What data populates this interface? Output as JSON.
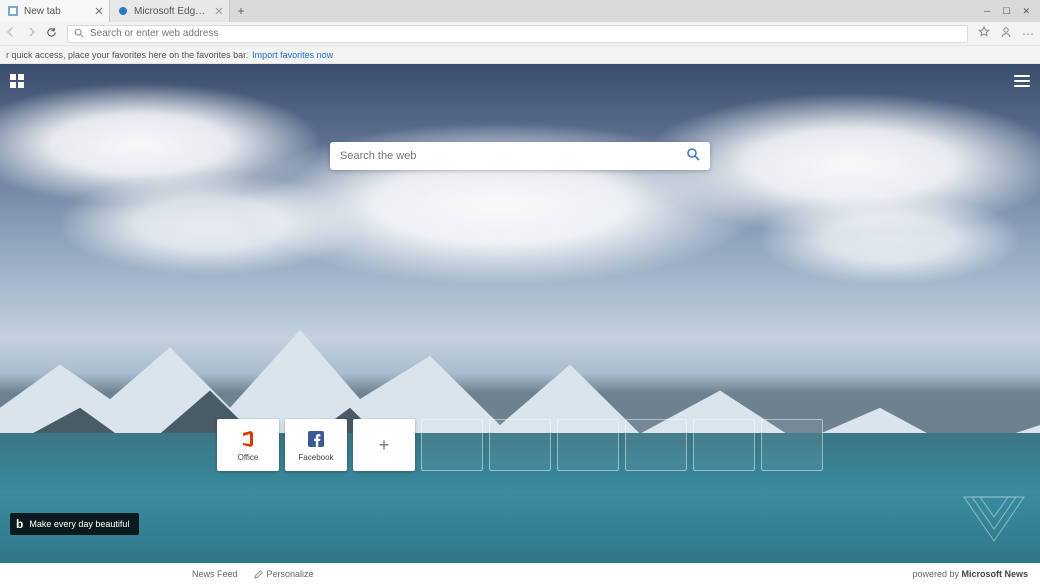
{
  "tabs": [
    {
      "title": "New tab",
      "active": true
    },
    {
      "title": "Microsoft Edge Insider",
      "active": false
    }
  ],
  "address_bar": {
    "placeholder": "Search or enter web address"
  },
  "favorites_bar": {
    "hint": "r quick access, place your favorites here on the favorites bar.",
    "link": "Import favorites now"
  },
  "ntp": {
    "web_search_placeholder": "Search the web",
    "tiles": [
      {
        "type": "site",
        "label": "Office",
        "icon": "office"
      },
      {
        "type": "site",
        "label": "Facebook",
        "icon": "facebook"
      },
      {
        "type": "add"
      },
      {
        "type": "empty"
      },
      {
        "type": "empty"
      },
      {
        "type": "empty"
      },
      {
        "type": "empty"
      },
      {
        "type": "empty"
      },
      {
        "type": "empty"
      }
    ],
    "bing_caption": "Make every day beautiful"
  },
  "footer": {
    "news_feed": "News Feed",
    "personalize": "Personalize",
    "powered_by_prefix": "powered by",
    "powered_by_brand": "Microsoft News"
  }
}
